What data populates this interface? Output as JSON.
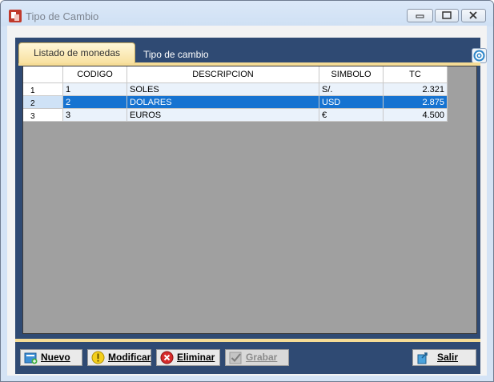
{
  "window": {
    "title": "Tipo de Cambio",
    "app_icon": "app-icon",
    "controls": [
      "minimize-icon",
      "maximize-icon",
      "close-icon"
    ]
  },
  "tabs": [
    {
      "label": "Listado de monedas",
      "active": true
    },
    {
      "label": "Tipo de cambio",
      "active": false
    }
  ],
  "grid": {
    "columns": [
      "CODIGO",
      "DESCRIPCION",
      "SIMBOLO",
      "TC"
    ],
    "rows": [
      {
        "index": "1",
        "codigo": "1",
        "descripcion": "SOLES",
        "simbolo": "S/.",
        "tc": "2.321",
        "selected": false
      },
      {
        "index": "2",
        "codigo": "2",
        "descripcion": "DOLARES",
        "simbolo": "USD",
        "tc": "2.875",
        "selected": true
      },
      {
        "index": "3",
        "codigo": "3",
        "descripcion": "EUROS",
        "simbolo": "€",
        "tc": "4.500",
        "selected": false
      }
    ]
  },
  "toolbar": {
    "nuevo": "Nuevo",
    "modificar": "Modificar",
    "eliminar": "Eliminar",
    "grabar": "Grabar",
    "salir": "Salir"
  },
  "colors": {
    "panel_navy": "#2f4a73",
    "tab_gold": "#f5dc96",
    "selection_blue": "#1673d1",
    "grid_background": "#a0a0a0"
  }
}
